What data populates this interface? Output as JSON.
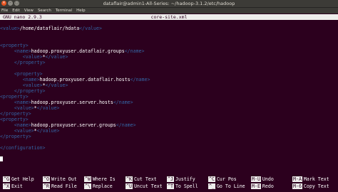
{
  "window": {
    "title": "dataflair@admin1-All-Series: ~/hadoop-3.1.2/etc/hadoop",
    "buttons": [
      "×",
      "–",
      "□"
    ]
  },
  "menu": [
    "File",
    "Edit",
    "View",
    "Search",
    "Terminal",
    "Help"
  ],
  "editor": {
    "version": "GNU nano 2.9.3",
    "filename": "core-site.xml",
    "lines": [
      {
        "indent": "",
        "open": "<value>",
        "text": "/home/dataflair/hdata",
        "close": "</value>"
      },
      {
        "indent": "",
        "open": "",
        "text": "",
        "close": ""
      },
      {
        "indent": "",
        "open": "",
        "text": "",
        "close": ""
      },
      {
        "indent": "",
        "open": "<property>",
        "text": "",
        "close": ""
      },
      {
        "indent": "     ",
        "open": "<name>",
        "text": "hadoop.proxyuser.dataflair.groups",
        "close": "</name>"
      },
      {
        "indent": "        ",
        "open": "<value>",
        "text": "*",
        "close": "</value>"
      },
      {
        "indent": "     ",
        "open": "</property>",
        "text": "",
        "close": ""
      },
      {
        "indent": "",
        "open": "",
        "text": "",
        "close": ""
      },
      {
        "indent": "     ",
        "open": "<property>",
        "text": "",
        "close": ""
      },
      {
        "indent": "        ",
        "open": "<name>",
        "text": "hadoop.proxyuser.dataflair.hosts",
        "close": "</name>"
      },
      {
        "indent": "        ",
        "open": "<value>",
        "text": "*",
        "close": "</value>"
      },
      {
        "indent": "     ",
        "open": "</property>",
        "text": "",
        "close": ""
      },
      {
        "indent": "",
        "open": "<property>",
        "text": "",
        "close": ""
      },
      {
        "indent": "     ",
        "open": "<name>",
        "text": "hadoop.proxyuser.server.hosts",
        "close": "</name>"
      },
      {
        "indent": "     ",
        "open": "<value>",
        "text": "*",
        "close": "</value>"
      },
      {
        "indent": "",
        "open": "</property>",
        "text": "",
        "close": ""
      },
      {
        "indent": "",
        "open": "<property>",
        "text": "",
        "close": ""
      },
      {
        "indent": "     ",
        "open": "<name>",
        "text": "hadoop.proxyuser.server.groups",
        "close": "</name>"
      },
      {
        "indent": "     ",
        "open": "<value>",
        "text": "*",
        "close": "</value>"
      },
      {
        "indent": "",
        "open": "</property>",
        "text": "",
        "close": ""
      },
      {
        "indent": "",
        "open": "",
        "text": "",
        "close": ""
      },
      {
        "indent": "",
        "open": "</configuration>",
        "text": "",
        "close": ""
      }
    ]
  },
  "shortcuts": [
    [
      {
        "key": "^G",
        "label": "Get Help"
      },
      {
        "key": "^O",
        "label": "Write Out"
      },
      {
        "key": "^W",
        "label": "Where Is"
      },
      {
        "key": "^K",
        "label": "Cut Text"
      },
      {
        "key": "^J",
        "label": "Justify"
      },
      {
        "key": "^C",
        "label": "Cur Pos"
      },
      {
        "key": "M-U",
        "label": "Undo"
      },
      {
        "key": "M-A",
        "label": "Mark Text"
      }
    ],
    [
      {
        "key": "^X",
        "label": "Exit"
      },
      {
        "key": "^R",
        "label": "Read File"
      },
      {
        "key": "^\\",
        "label": "Replace"
      },
      {
        "key": "^U",
        "label": "Uncut Text"
      },
      {
        "key": "^T",
        "label": "To Spell"
      },
      {
        "key": "^_",
        "label": "Go To Line"
      },
      {
        "key": "M-E",
        "label": "Redo"
      },
      {
        "key": "M-6",
        "label": "Copy Text"
      }
    ]
  ],
  "colors": {
    "background": "#2c001e",
    "tag": "#3465a4",
    "bar": "#eeeeec"
  }
}
